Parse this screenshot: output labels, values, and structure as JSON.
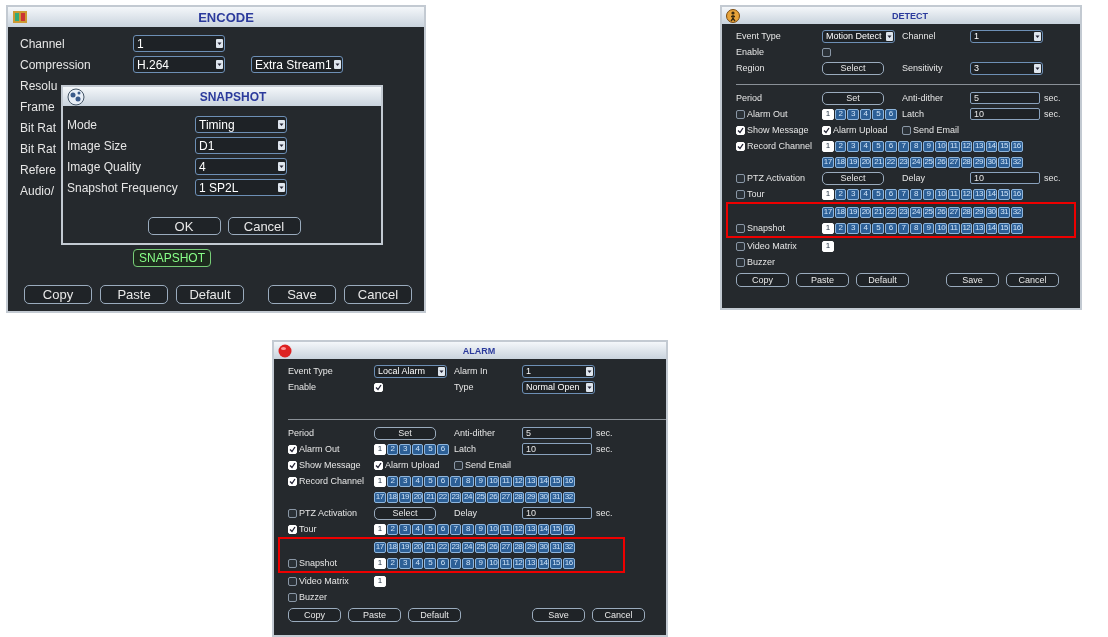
{
  "windows": [
    {
      "kind": "encode",
      "title": "ENCODE",
      "rows": [
        {
          "label": "Channel",
          "controls": [
            {
              "kind": "dropdown",
              "value": "1"
            }
          ]
        },
        {
          "label": "Compression",
          "controls": [
            {
              "kind": "dropdown",
              "value": "H.264"
            },
            {
              "kind": "dropdown",
              "value": "Extra Stream1"
            }
          ]
        },
        {
          "label": "Resolu",
          "controls": []
        },
        {
          "label": "Frame",
          "controls": []
        },
        {
          "label": "Bit Rat",
          "controls": []
        },
        {
          "label": "Bit Rat",
          "controls": []
        },
        {
          "label": "Refere",
          "controls": []
        },
        {
          "label": "Audio/",
          "controls": []
        }
      ],
      "snapshot_button": "SNAPSHOT",
      "buttons_left": [
        "Copy",
        "Paste",
        "Default"
      ],
      "buttons_right": [
        "Save",
        "Cancel"
      ],
      "dialog": {
        "title": "SNAPSHOT",
        "rows": [
          {
            "label": "Mode",
            "value": "Timing"
          },
          {
            "label": "Image Size",
            "value": "D1"
          },
          {
            "label": "Image Quality",
            "value": "4"
          },
          {
            "label": "Snapshot Frequency",
            "value": "1 SP2L"
          }
        ],
        "buttons": [
          "OK",
          "Cancel"
        ]
      }
    },
    {
      "kind": "detect",
      "title": "DETECT",
      "header_rows": [
        {
          "cells": [
            {
              "kind": "label",
              "text": "Event Type"
            },
            {
              "kind": "dropdown",
              "value": "Motion Detect"
            },
            {
              "kind": "label",
              "text": "Channel"
            },
            {
              "kind": "dropdown",
              "value": "1"
            }
          ]
        },
        {
          "cells": [
            {
              "kind": "label",
              "text": "Enable"
            },
            {
              "kind": "checkbox",
              "checked": false
            }
          ]
        },
        {
          "cells": [
            {
              "kind": "label",
              "text": "Region"
            },
            {
              "kind": "button",
              "text": "Select"
            },
            {
              "kind": "label",
              "text": "Sensitivity"
            },
            {
              "kind": "dropdown",
              "value": "3"
            }
          ]
        }
      ],
      "rows": [
        {
          "highlighted": false,
          "cells": [
            {
              "kind": "label",
              "text": "Period"
            },
            {
              "kind": "button",
              "text": "Set"
            },
            {
              "kind": "label",
              "text": "Anti-dither"
            },
            {
              "kind": "field",
              "value": "5"
            },
            {
              "kind": "unit",
              "text": "sec."
            }
          ]
        },
        {
          "highlighted": false,
          "cells": [
            {
              "kind": "check",
              "label": "Alarm Out",
              "checked": false
            },
            {
              "kind": "channels",
              "items": [
                {
                  "label": "1",
                  "selected": true
                },
                {
                  "label": "2",
                  "selected": false
                },
                {
                  "label": "3",
                  "selected": false
                },
                {
                  "label": "4",
                  "selected": false
                },
                {
                  "label": "5",
                  "selected": false
                },
                {
                  "label": "6",
                  "selected": false
                }
              ]
            },
            {
              "kind": "label",
              "text": "Latch"
            },
            {
              "kind": "field",
              "value": "10"
            },
            {
              "kind": "unit",
              "text": "sec."
            }
          ]
        },
        {
          "highlighted": false,
          "cells": [
            {
              "kind": "check",
              "label": "Show Message",
              "checked": true
            },
            {
              "kind": "check",
              "label": "Alarm Upload",
              "checked": true
            },
            {
              "kind": "check",
              "label": "Send Email",
              "checked": false
            }
          ]
        },
        {
          "highlighted": false,
          "cells": [
            {
              "kind": "check",
              "label": "Record Channel",
              "checked": true
            },
            {
              "kind": "channels",
              "items": [
                {
                  "label": "1",
                  "selected": true
                },
                {
                  "label": "2",
                  "selected": false
                },
                {
                  "label": "3",
                  "selected": false
                },
                {
                  "label": "4",
                  "selected": false
                },
                {
                  "label": "5",
                  "selected": false
                },
                {
                  "label": "6",
                  "selected": false
                },
                {
                  "label": "7",
                  "selected": false
                },
                {
                  "label": "8",
                  "selected": false
                },
                {
                  "label": "9",
                  "selected": false
                },
                {
                  "label": "10",
                  "selected": false
                },
                {
                  "label": "11",
                  "selected": false
                },
                {
                  "label": "12",
                  "selected": false
                },
                {
                  "label": "13",
                  "selected": false
                },
                {
                  "label": "14",
                  "selected": false
                },
                {
                  "label": "15",
                  "selected": false
                },
                {
                  "label": "16",
                  "selected": false
                }
              ]
            }
          ]
        },
        {
          "highlighted": false,
          "indent": true,
          "cells": [
            {
              "kind": "channels",
              "items": [
                {
                  "label": "17",
                  "selected": false
                },
                {
                  "label": "18",
                  "selected": false
                },
                {
                  "label": "19",
                  "selected": false
                },
                {
                  "label": "20",
                  "selected": false
                },
                {
                  "label": "21",
                  "selected": false
                },
                {
                  "label": "22",
                  "selected": false
                },
                {
                  "label": "23",
                  "selected": false
                },
                {
                  "label": "24",
                  "selected": false
                },
                {
                  "label": "25",
                  "selected": false
                },
                {
                  "label": "26",
                  "selected": false
                },
                {
                  "label": "27",
                  "selected": false
                },
                {
                  "label": "28",
                  "selected": false
                },
                {
                  "label": "29",
                  "selected": false
                },
                {
                  "label": "30",
                  "selected": false
                },
                {
                  "label": "31",
                  "selected": false
                },
                {
                  "label": "32",
                  "selected": false
                }
              ]
            }
          ]
        },
        {
          "highlighted": false,
          "cells": [
            {
              "kind": "check",
              "label": "PTZ Activation",
              "checked": false
            },
            {
              "kind": "button",
              "text": "Select"
            },
            {
              "kind": "label",
              "text": "Delay"
            },
            {
              "kind": "field",
              "value": "10"
            },
            {
              "kind": "unit",
              "text": "sec."
            }
          ]
        },
        {
          "highlighted": false,
          "cells": [
            {
              "kind": "check",
              "label": "Tour",
              "checked": false
            },
            {
              "kind": "channels",
              "items": [
                {
                  "label": "1",
                  "selected": true
                },
                {
                  "label": "2",
                  "selected": false
                },
                {
                  "label": "3",
                  "selected": false
                },
                {
                  "label": "4",
                  "selected": false
                },
                {
                  "label": "5",
                  "selected": false
                },
                {
                  "label": "6",
                  "selected": false
                },
                {
                  "label": "7",
                  "selected": false
                },
                {
                  "label": "8",
                  "selected": false
                },
                {
                  "label": "9",
                  "selected": false
                },
                {
                  "label": "10",
                  "selected": false
                },
                {
                  "label": "11",
                  "selected": false
                },
                {
                  "label": "12",
                  "selected": false
                },
                {
                  "label": "13",
                  "selected": false
                },
                {
                  "label": "14",
                  "selected": false
                },
                {
                  "label": "15",
                  "selected": false
                },
                {
                  "label": "16",
                  "selected": false
                }
              ]
            }
          ]
        },
        {
          "highlighted": true,
          "indent": true,
          "cells": [
            {
              "kind": "channels",
              "items": [
                {
                  "label": "17",
                  "selected": false
                },
                {
                  "label": "18",
                  "selected": false
                },
                {
                  "label": "19",
                  "selected": false
                },
                {
                  "label": "20",
                  "selected": false
                },
                {
                  "label": "21",
                  "selected": false
                },
                {
                  "label": "22",
                  "selected": false
                },
                {
                  "label": "23",
                  "selected": false
                },
                {
                  "label": "24",
                  "selected": false
                },
                {
                  "label": "25",
                  "selected": false
                },
                {
                  "label": "26",
                  "selected": false
                },
                {
                  "label": "27",
                  "selected": false
                },
                {
                  "label": "28",
                  "selected": false
                },
                {
                  "label": "29",
                  "selected": false
                },
                {
                  "label": "30",
                  "selected": false
                },
                {
                  "label": "31",
                  "selected": false
                },
                {
                  "label": "32",
                  "selected": false
                }
              ]
            }
          ]
        },
        {
          "highlighted": true,
          "cells": [
            {
              "kind": "check",
              "label": "Snapshot",
              "checked": false
            },
            {
              "kind": "channels",
              "items": [
                {
                  "label": "1",
                  "selected": true
                },
                {
                  "label": "2",
                  "selected": false
                },
                {
                  "label": "3",
                  "selected": false
                },
                {
                  "label": "4",
                  "selected": false
                },
                {
                  "label": "5",
                  "selected": false
                },
                {
                  "label": "6",
                  "selected": false
                },
                {
                  "label": "7",
                  "selected": false
                },
                {
                  "label": "8",
                  "selected": false
                },
                {
                  "label": "9",
                  "selected": false
                },
                {
                  "label": "10",
                  "selected": false
                },
                {
                  "label": "11",
                  "selected": false
                },
                {
                  "label": "12",
                  "selected": false
                },
                {
                  "label": "13",
                  "selected": false
                },
                {
                  "label": "14",
                  "selected": false
                },
                {
                  "label": "15",
                  "selected": false
                },
                {
                  "label": "16",
                  "selected": false
                }
              ]
            }
          ]
        },
        {
          "highlighted": false,
          "cells": [
            {
              "kind": "check",
              "label": "Video Matrix",
              "checked": false
            },
            {
              "kind": "channels",
              "items": [
                {
                  "label": "1",
                  "selected": true
                }
              ]
            }
          ]
        },
        {
          "highlighted": false,
          "cells": [
            {
              "kind": "check",
              "label": "Buzzer",
              "checked": false
            }
          ]
        }
      ],
      "buttons_left": [
        "Copy",
        "Paste",
        "Default"
      ],
      "buttons_right": [
        "Save",
        "Cancel"
      ]
    },
    {
      "kind": "alarm",
      "title": "ALARM",
      "header_rows": [
        {
          "cells": [
            {
              "kind": "label",
              "text": "Event Type"
            },
            {
              "kind": "dropdown",
              "value": "Local Alarm"
            },
            {
              "kind": "label",
              "text": "Alarm In"
            },
            {
              "kind": "dropdown",
              "value": "1"
            }
          ]
        },
        {
          "cells": [
            {
              "kind": "label",
              "text": "Enable"
            },
            {
              "kind": "checkbox",
              "checked": true
            },
            {
              "kind": "label",
              "text": "Type"
            },
            {
              "kind": "dropdown",
              "value": "Normal Open"
            }
          ]
        }
      ],
      "rows": [
        {
          "highlighted": false,
          "cells": [
            {
              "kind": "label",
              "text": "Period"
            },
            {
              "kind": "button",
              "text": "Set"
            },
            {
              "kind": "label",
              "text": "Anti-dither"
            },
            {
              "kind": "field",
              "value": "5"
            },
            {
              "kind": "unit",
              "text": "sec."
            }
          ]
        },
        {
          "highlighted": false,
          "cells": [
            {
              "kind": "check",
              "label": "Alarm Out",
              "checked": true
            },
            {
              "kind": "channels",
              "items": [
                {
                  "label": "1",
                  "selected": true
                },
                {
                  "label": "2",
                  "selected": false
                },
                {
                  "label": "3",
                  "selected": false
                },
                {
                  "label": "4",
                  "selected": false
                },
                {
                  "label": "5",
                  "selected": false
                },
                {
                  "label": "6",
                  "selected": false
                }
              ]
            },
            {
              "kind": "label",
              "text": "Latch"
            },
            {
              "kind": "field",
              "value": "10"
            },
            {
              "kind": "unit",
              "text": "sec."
            }
          ]
        },
        {
          "highlighted": false,
          "cells": [
            {
              "kind": "check",
              "label": "Show Message",
              "checked": true
            },
            {
              "kind": "check",
              "label": "Alarm Upload",
              "checked": true
            },
            {
              "kind": "check",
              "label": "Send Email",
              "checked": false
            }
          ]
        },
        {
          "highlighted": false,
          "cells": [
            {
              "kind": "check",
              "label": "Record Channel",
              "checked": true
            },
            {
              "kind": "channels",
              "items": [
                {
                  "label": "1",
                  "selected": true
                },
                {
                  "label": "2",
                  "selected": false
                },
                {
                  "label": "3",
                  "selected": false
                },
                {
                  "label": "4",
                  "selected": false
                },
                {
                  "label": "5",
                  "selected": false
                },
                {
                  "label": "6",
                  "selected": false
                },
                {
                  "label": "7",
                  "selected": false
                },
                {
                  "label": "8",
                  "selected": false
                },
                {
                  "label": "9",
                  "selected": false
                },
                {
                  "label": "10",
                  "selected": false
                },
                {
                  "label": "11",
                  "selected": false
                },
                {
                  "label": "12",
                  "selected": false
                },
                {
                  "label": "13",
                  "selected": false
                },
                {
                  "label": "14",
                  "selected": false
                },
                {
                  "label": "15",
                  "selected": false
                },
                {
                  "label": "16",
                  "selected": false
                }
              ]
            }
          ]
        },
        {
          "highlighted": false,
          "indent": true,
          "cells": [
            {
              "kind": "channels",
              "items": [
                {
                  "label": "17",
                  "selected": false
                },
                {
                  "label": "18",
                  "selected": false
                },
                {
                  "label": "19",
                  "selected": false
                },
                {
                  "label": "20",
                  "selected": false
                },
                {
                  "label": "21",
                  "selected": false
                },
                {
                  "label": "22",
                  "selected": false
                },
                {
                  "label": "23",
                  "selected": false
                },
                {
                  "label": "24",
                  "selected": false
                },
                {
                  "label": "25",
                  "selected": false
                },
                {
                  "label": "26",
                  "selected": false
                },
                {
                  "label": "27",
                  "selected": false
                },
                {
                  "label": "28",
                  "selected": false
                },
                {
                  "label": "29",
                  "selected": false
                },
                {
                  "label": "30",
                  "selected": false
                },
                {
                  "label": "31",
                  "selected": false
                },
                {
                  "label": "32",
                  "selected": false
                }
              ]
            }
          ]
        },
        {
          "highlighted": false,
          "cells": [
            {
              "kind": "check",
              "label": "PTZ Activation",
              "checked": false
            },
            {
              "kind": "button",
              "text": "Select"
            },
            {
              "kind": "label",
              "text": "Delay"
            },
            {
              "kind": "field",
              "value": "10"
            },
            {
              "kind": "unit",
              "text": "sec."
            }
          ]
        },
        {
          "highlighted": false,
          "cells": [
            {
              "kind": "check",
              "label": "Tour",
              "checked": true
            },
            {
              "kind": "channels",
              "items": [
                {
                  "label": "1",
                  "selected": true
                },
                {
                  "label": "2",
                  "selected": false
                },
                {
                  "label": "3",
                  "selected": false
                },
                {
                  "label": "4",
                  "selected": false
                },
                {
                  "label": "5",
                  "selected": false
                },
                {
                  "label": "6",
                  "selected": false
                },
                {
                  "label": "7",
                  "selected": false
                },
                {
                  "label": "8",
                  "selected": false
                },
                {
                  "label": "9",
                  "selected": false
                },
                {
                  "label": "10",
                  "selected": false
                },
                {
                  "label": "11",
                  "selected": false
                },
                {
                  "label": "12",
                  "selected": false
                },
                {
                  "label": "13",
                  "selected": false
                },
                {
                  "label": "14",
                  "selected": false
                },
                {
                  "label": "15",
                  "selected": false
                },
                {
                  "label": "16",
                  "selected": false
                }
              ]
            }
          ]
        },
        {
          "highlighted": true,
          "indent": true,
          "cells": [
            {
              "kind": "channels",
              "items": [
                {
                  "label": "17",
                  "selected": false
                },
                {
                  "label": "18",
                  "selected": false
                },
                {
                  "label": "19",
                  "selected": false
                },
                {
                  "label": "20",
                  "selected": false
                },
                {
                  "label": "21",
                  "selected": false
                },
                {
                  "label": "22",
                  "selected": false
                },
                {
                  "label": "23",
                  "selected": false
                },
                {
                  "label": "24",
                  "selected": false
                },
                {
                  "label": "25",
                  "selected": false
                },
                {
                  "label": "26",
                  "selected": false
                },
                {
                  "label": "27",
                  "selected": false
                },
                {
                  "label": "28",
                  "selected": false
                },
                {
                  "label": "29",
                  "selected": false
                },
                {
                  "label": "30",
                  "selected": false
                },
                {
                  "label": "31",
                  "selected": false
                },
                {
                  "label": "32",
                  "selected": false
                }
              ]
            }
          ]
        },
        {
          "highlighted": true,
          "cells": [
            {
              "kind": "check",
              "label": "Snapshot",
              "checked": false
            },
            {
              "kind": "channels",
              "items": [
                {
                  "label": "1",
                  "selected": true
                },
                {
                  "label": "2",
                  "selected": false
                },
                {
                  "label": "3",
                  "selected": false
                },
                {
                  "label": "4",
                  "selected": false
                },
                {
                  "label": "5",
                  "selected": false
                },
                {
                  "label": "6",
                  "selected": false
                },
                {
                  "label": "7",
                  "selected": false
                },
                {
                  "label": "8",
                  "selected": false
                },
                {
                  "label": "9",
                  "selected": false
                },
                {
                  "label": "10",
                  "selected": false
                },
                {
                  "label": "11",
                  "selected": false
                },
                {
                  "label": "12",
                  "selected": false
                },
                {
                  "label": "13",
                  "selected": false
                },
                {
                  "label": "14",
                  "selected": false
                },
                {
                  "label": "15",
                  "selected": false
                },
                {
                  "label": "16",
                  "selected": false
                }
              ]
            }
          ]
        },
        {
          "highlighted": false,
          "cells": [
            {
              "kind": "check",
              "label": "Video Matrix",
              "checked": false
            },
            {
              "kind": "channels",
              "items": [
                {
                  "label": "1",
                  "selected": true
                }
              ]
            }
          ]
        },
        {
          "highlighted": false,
          "cells": [
            {
              "kind": "check",
              "label": "Buzzer",
              "checked": false
            }
          ]
        }
      ],
      "buttons_left": [
        "Copy",
        "Paste",
        "Default"
      ],
      "buttons_right": [
        "Save",
        "Cancel"
      ]
    }
  ]
}
